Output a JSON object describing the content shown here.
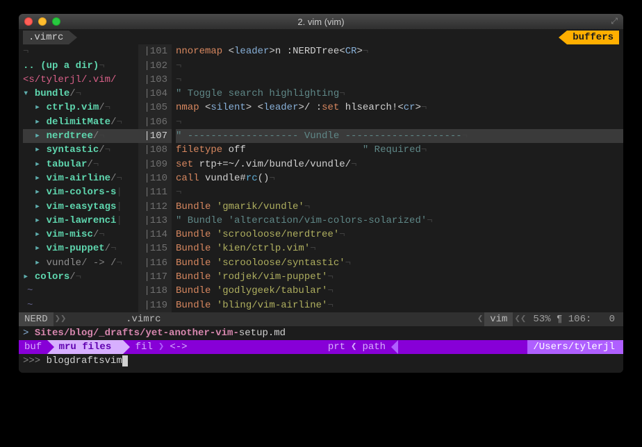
{
  "window": {
    "title": "2. vim (vim)"
  },
  "tabs": {
    "active": ".vimrc",
    "buffers_label": "buffers"
  },
  "nerdtree": {
    "header_eol": "¬",
    "updir": ".. (up a dir)",
    "path": "<s/tylerjl/.vim/",
    "items": [
      {
        "indent": "▾ ",
        "name": "bundle",
        "slash": "/",
        "style": "dir"
      },
      {
        "indent": "  ▸ ",
        "name": "ctrlp.vim",
        "slash": "/",
        "style": "dir"
      },
      {
        "indent": "  ▸ ",
        "name": "delimitMate",
        "slash": "/",
        "style": "dir"
      },
      {
        "indent": "  ▸ ",
        "name": "nerdtree",
        "slash": "/",
        "style": "dir",
        "hl": true
      },
      {
        "indent": "  ▸ ",
        "name": "syntastic",
        "slash": "/",
        "style": "dir"
      },
      {
        "indent": "  ▸ ",
        "name": "tabular",
        "slash": "/",
        "style": "dir"
      },
      {
        "indent": "  ▸ ",
        "name": "vim-airline",
        "slash": "/",
        "style": "dir"
      },
      {
        "indent": "  ▸ ",
        "name": "vim-colors-s",
        "slash": "",
        "style": "dir-trunc"
      },
      {
        "indent": "  ▸ ",
        "name": "vim-easytags",
        "slash": "",
        "style": "dir-trunc"
      },
      {
        "indent": "  ▸ ",
        "name": "vim-lawrenci",
        "slash": "",
        "style": "dir-trunc"
      },
      {
        "indent": "  ▸ ",
        "name": "vim-misc",
        "slash": "/",
        "style": "dir"
      },
      {
        "indent": "  ▸ ",
        "name": "vim-puppet",
        "slash": "/",
        "style": "dir"
      },
      {
        "indent": "  ▸ ",
        "name": "vundle",
        "slash": "/ -> /",
        "style": "link"
      },
      {
        "indent": "▸ ",
        "name": "colors",
        "slash": "/",
        "style": "dir"
      }
    ]
  },
  "code": {
    "lines": [
      {
        "n": 101,
        "tokens": [
          [
            "kw",
            "nnoremap "
          ],
          [
            "punct",
            "<"
          ],
          [
            "tag",
            "leader"
          ],
          [
            "punct",
            ">"
          ],
          [
            "op",
            "n :NERDTree"
          ],
          [
            "punct",
            "<"
          ],
          [
            "tag",
            "CR"
          ],
          [
            "punct",
            ">"
          ],
          [
            "eol",
            "¬"
          ]
        ]
      },
      {
        "n": 102,
        "tokens": [
          [
            "eol",
            "¬"
          ]
        ]
      },
      {
        "n": 103,
        "tokens": [
          [
            "eol",
            "¬"
          ]
        ]
      },
      {
        "n": 104,
        "tokens": [
          [
            "comment",
            "\" Toggle search highlighting"
          ],
          [
            "eol",
            "¬"
          ]
        ]
      },
      {
        "n": 105,
        "tokens": [
          [
            "kw",
            "nmap "
          ],
          [
            "punct",
            "<"
          ],
          [
            "tag",
            "silent"
          ],
          [
            "punct",
            "> <"
          ],
          [
            "tag",
            "leader"
          ],
          [
            "punct",
            ">"
          ],
          [
            "op",
            "/ :"
          ],
          [
            "kw",
            "set"
          ],
          [
            "op",
            " hlsearch!"
          ],
          [
            "punct",
            "<"
          ],
          [
            "tag",
            "cr"
          ],
          [
            "punct",
            ">"
          ],
          [
            "eol",
            "¬"
          ]
        ]
      },
      {
        "n": 106,
        "tokens": [
          [
            "eol",
            "¬"
          ]
        ]
      },
      {
        "n": 107,
        "hl": true,
        "tokens": [
          [
            "comment",
            "\" ------------------- Vundle --------------------"
          ],
          [
            "eol",
            "¬"
          ]
        ]
      },
      {
        "n": 108,
        "tokens": [
          [
            "kw",
            "filetype"
          ],
          [
            "op",
            " off                    "
          ],
          [
            "comment",
            "\" Required"
          ],
          [
            "eol",
            "¬"
          ]
        ]
      },
      {
        "n": 109,
        "tokens": [
          [
            "kw",
            "set"
          ],
          [
            "op",
            " rtp+=~"
          ],
          [
            "op",
            "/.vim/bundle/vundle/"
          ],
          [
            "eol",
            "¬"
          ]
        ]
      },
      {
        "n": 110,
        "tokens": [
          [
            "kw",
            "call"
          ],
          [
            "op",
            " vundle#"
          ],
          [
            "func",
            "rc"
          ],
          [
            "punct",
            "()"
          ],
          [
            "eol",
            "¬"
          ]
        ]
      },
      {
        "n": 111,
        "tokens": [
          [
            "eol",
            "¬"
          ]
        ]
      },
      {
        "n": 112,
        "tokens": [
          [
            "kw",
            "Bundle "
          ],
          [
            "str",
            "'gmarik/vundle'"
          ],
          [
            "eol",
            "¬"
          ]
        ]
      },
      {
        "n": 113,
        "tokens": [
          [
            "comment",
            "\" Bundle 'altercation/vim-colors-solarized'"
          ],
          [
            "eol",
            "¬"
          ]
        ]
      },
      {
        "n": 114,
        "tokens": [
          [
            "kw",
            "Bundle "
          ],
          [
            "str",
            "'scrooloose/nerdtree'"
          ],
          [
            "eol",
            "¬"
          ]
        ]
      },
      {
        "n": 115,
        "tokens": [
          [
            "kw",
            "Bundle "
          ],
          [
            "str",
            "'kien/ctrlp.vim'"
          ],
          [
            "eol",
            "¬"
          ]
        ]
      },
      {
        "n": 116,
        "tokens": [
          [
            "kw",
            "Bundle "
          ],
          [
            "str",
            "'scrooloose/syntastic'"
          ],
          [
            "eol",
            "¬"
          ]
        ]
      },
      {
        "n": 117,
        "tokens": [
          [
            "kw",
            "Bundle "
          ],
          [
            "str",
            "'rodjek/vim-puppet'"
          ],
          [
            "eol",
            "¬"
          ]
        ]
      },
      {
        "n": 118,
        "tokens": [
          [
            "kw",
            "Bundle "
          ],
          [
            "str",
            "'godlygeek/tabular'"
          ],
          [
            "eol",
            "¬"
          ]
        ]
      },
      {
        "n": 119,
        "tokens": [
          [
            "kw",
            "Bundle "
          ],
          [
            "str",
            "'bling/vim-airline'"
          ],
          [
            "eol",
            "¬"
          ]
        ]
      }
    ]
  },
  "statusline": {
    "nerd": "NERD",
    "file": ".vimrc",
    "ft": "vim",
    "pct": "53%",
    "line": "106:",
    "col": "0"
  },
  "ctrlp": {
    "result_prefix": "> ",
    "result_path_hl": "Sites/blog/_drafts/yet-another-vim-",
    "result_path_rest": "setup.md",
    "modes": {
      "buf": "buf",
      "mru": "mru files",
      "fil": "fil",
      "regex": "<->"
    },
    "prt": "prt",
    "path_label": "path",
    "path": "/Users/tylerjl",
    "prompt_sym": ">>>",
    "input": "blogdraftsvim"
  }
}
